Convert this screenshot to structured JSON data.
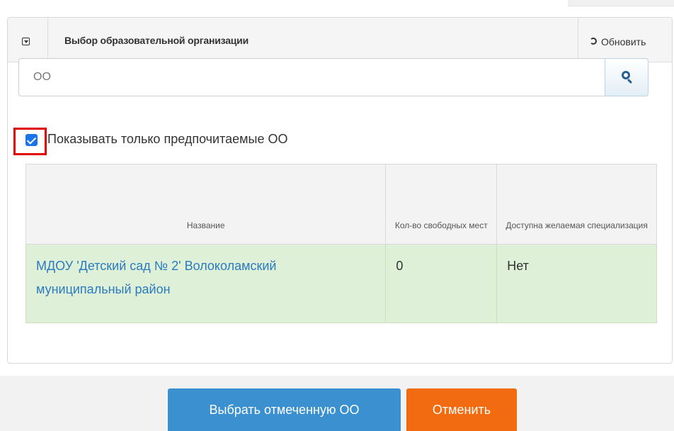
{
  "panel": {
    "title": "Выбор образовательной организации",
    "refresh_label": "Обновить"
  },
  "search": {
    "value": "ОО",
    "button_icon": "search-icon"
  },
  "filter": {
    "checked": true,
    "label": "Показывать только предпочитаемые ОО"
  },
  "table": {
    "columns": [
      "Название",
      "Кол-во свободных мест",
      "Доступна желаемая специализация"
    ],
    "rows": [
      {
        "name": "МДОУ 'Детский сад № 2' Волоколамский муниципальный район",
        "free_places": "0",
        "specialization": "Нет"
      }
    ]
  },
  "footer": {
    "select_label": "Выбрать отмеченную ОО",
    "cancel_label": "Отменить"
  },
  "colors": {
    "primary": "#3b90d0",
    "cancel": "#f26b10",
    "row_highlight": "#dff0d8",
    "link": "#2b7bbd",
    "checkbox_highlight": "#e00000"
  }
}
